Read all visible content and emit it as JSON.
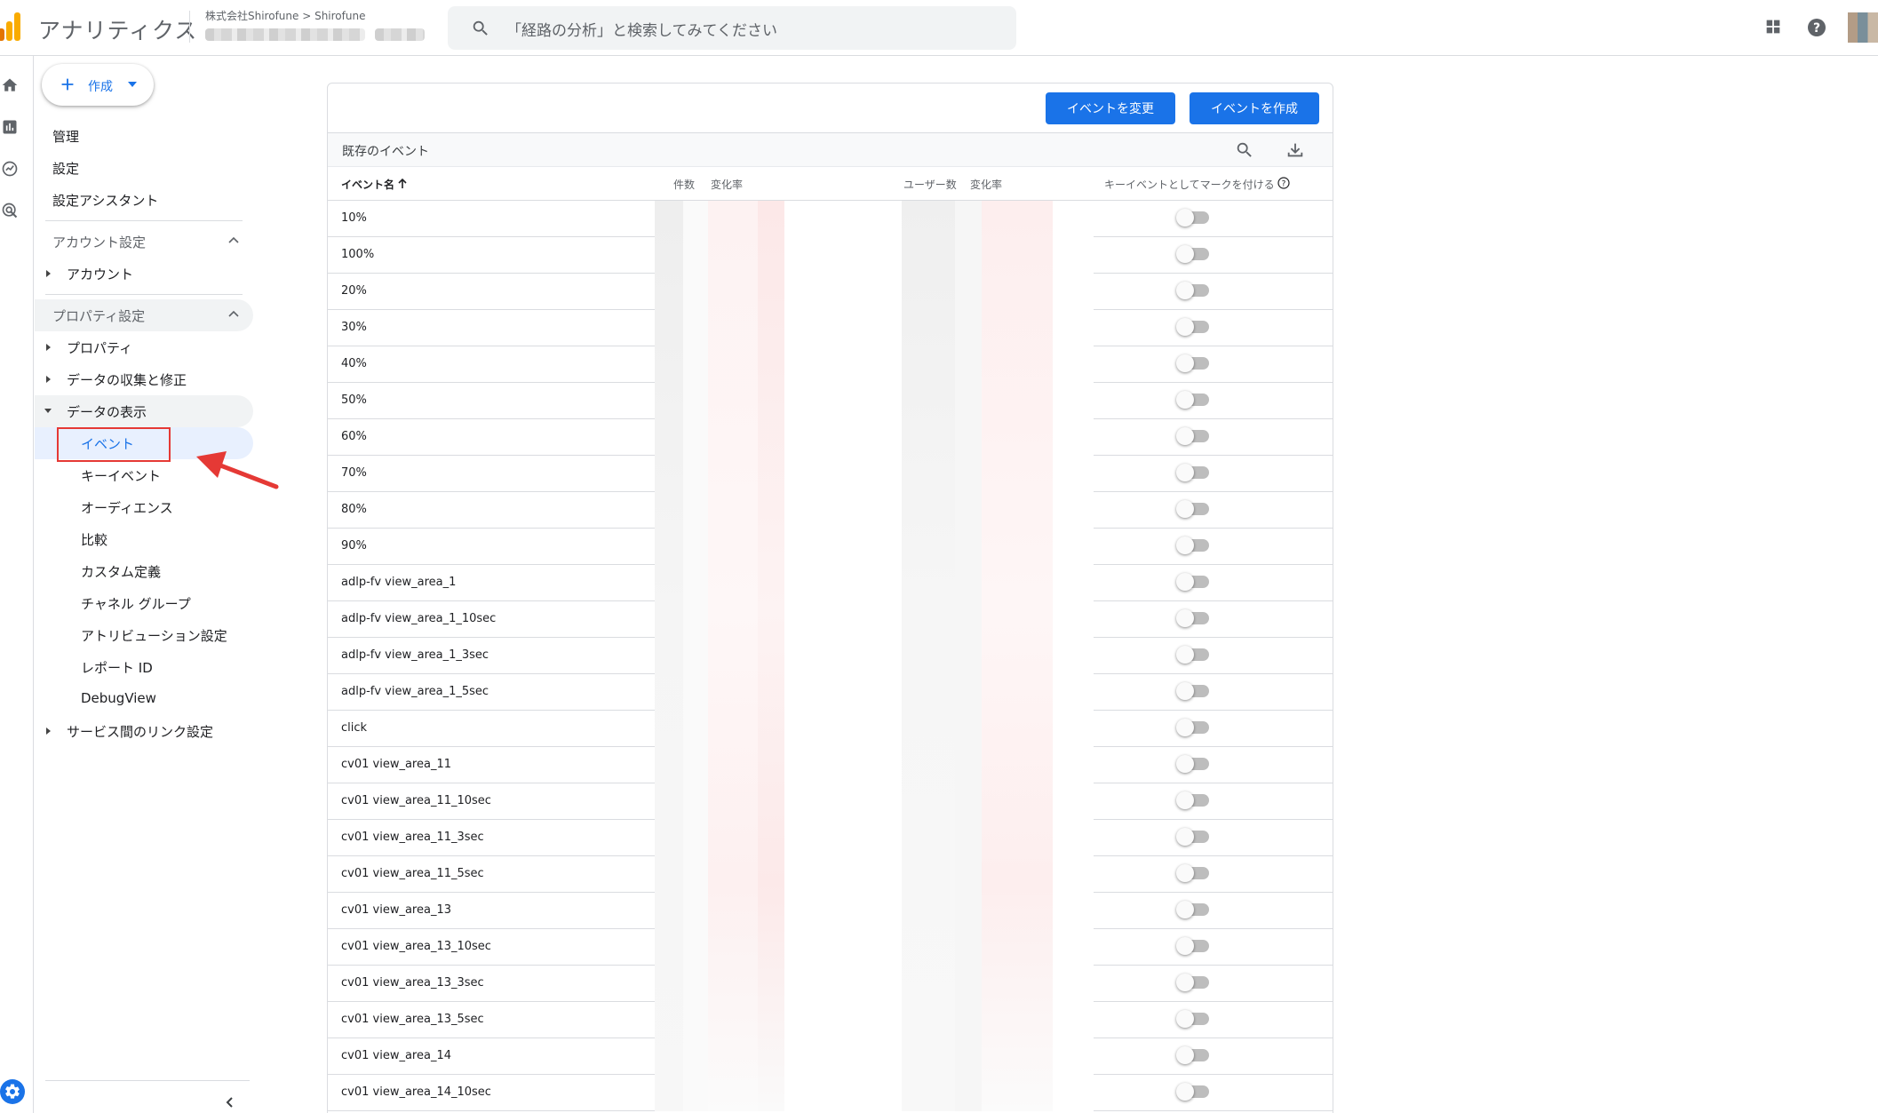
{
  "app": {
    "title": "アナリティクス",
    "account_crumb": "株式会社Shirofune > Shirofune",
    "search_placeholder": "「経路の分析」と検索してみてください"
  },
  "colors": {
    "accent": "#1a73e8",
    "logo_orange": "#f9ab00",
    "logo_dark_orange": "#e37400",
    "annotation_red": "#e53935"
  },
  "top_icons": [
    "apps-grid-icon",
    "help-icon"
  ],
  "rail_icons": [
    "home-icon",
    "reports-icon",
    "explore-icon",
    "advertising-icon",
    "settings-gear-icon"
  ],
  "nav": {
    "create_label": "作成",
    "top_items": [
      "管理",
      "設定",
      "設定アシスタント"
    ],
    "account_section": {
      "label": "アカウント設定",
      "items": [
        "アカウント"
      ]
    },
    "property_section": {
      "label": "プロパティ設定",
      "items": [
        "プロパティ",
        "データの収集と修正",
        "データの表示",
        "サービス間のリンク設定"
      ],
      "data_display_children": [
        "イベント",
        "キーイベント",
        "オーディエンス",
        "比較",
        "カスタム定義",
        "チャネル グループ",
        "アトリビューション設定",
        "レポート ID",
        "DebugView"
      ],
      "selected": "イベント"
    }
  },
  "events_card": {
    "modify_button": "イベントを変更",
    "create_button": "イベントを作成",
    "table_title": "既存のイベント",
    "columns": {
      "event_name": "イベント名",
      "count": "件数",
      "count_change": "変化率",
      "users": "ユーザー数",
      "users_change": "変化率",
      "mark_key_event": "キーイベントとしてマークを付ける"
    },
    "rows": [
      "10%",
      "100%",
      "20%",
      "30%",
      "40%",
      "50%",
      "60%",
      "70%",
      "80%",
      "90%",
      "adlp-fv view_area_1",
      "adlp-fv view_area_1_10sec",
      "adlp-fv view_area_1_3sec",
      "adlp-fv view_area_1_5sec",
      "click",
      "cv01 view_area_11",
      "cv01 view_area_11_10sec",
      "cv01 view_area_11_3sec",
      "cv01 view_area_11_5sec",
      "cv01 view_area_13",
      "cv01 view_area_13_10sec",
      "cv01 view_area_13_3sec",
      "cv01 view_area_13_5sec",
      "cv01 view_area_14",
      "cv01 view_area_14_10sec"
    ],
    "key_event_toggles_on": 0
  }
}
